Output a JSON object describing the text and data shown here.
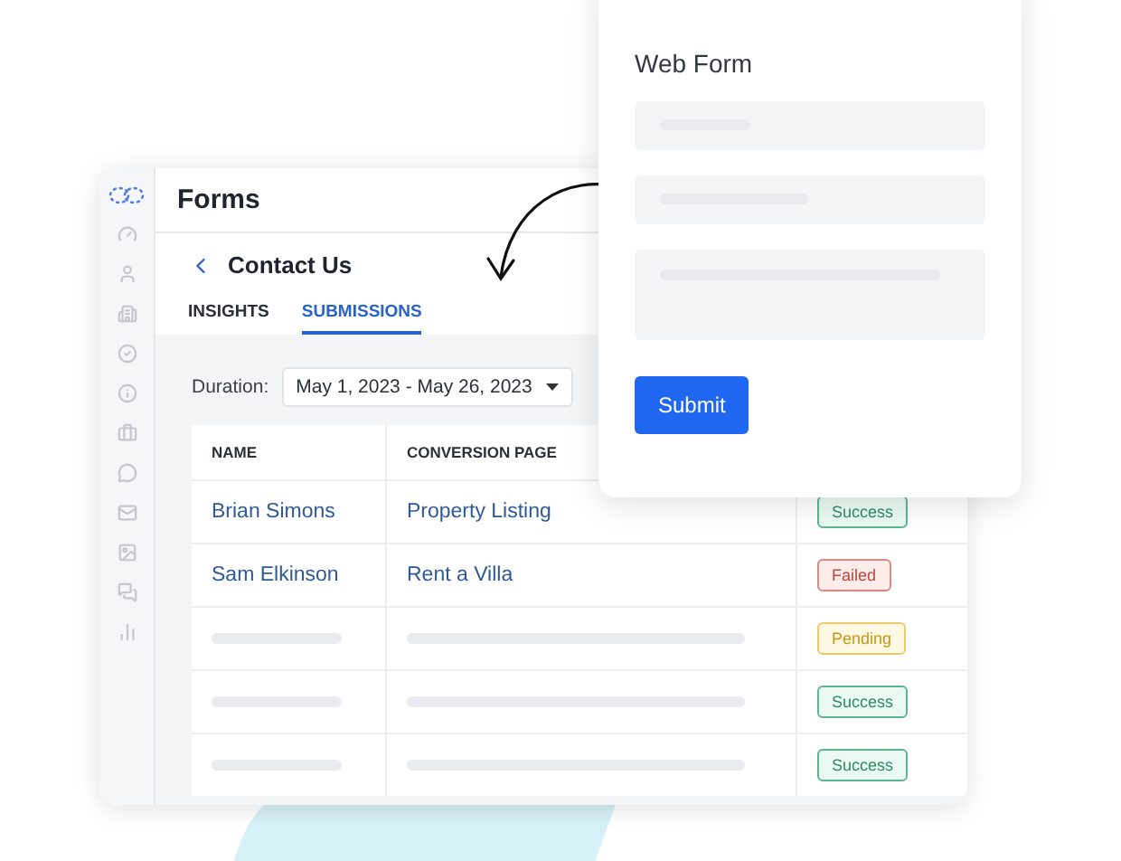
{
  "app": {
    "title": "Forms",
    "page_title": "Contact Us",
    "tabs": [
      {
        "label": "INSIGHTS",
        "selected": false
      },
      {
        "label": "SUBMISSIONS",
        "selected": true
      }
    ],
    "duration": {
      "label": "Duration:",
      "value": "May 1, 2023 - May 26, 2023"
    },
    "table": {
      "columns": [
        "NAME",
        "CONVERSION PAGE"
      ],
      "rows": [
        {
          "kind": "filled",
          "name": "Brian Simons",
          "page": "Property Listing",
          "status": {
            "label": "Success",
            "kind": "success"
          }
        },
        {
          "kind": "filled",
          "name": "Sam Elkinson",
          "page": "Rent a Villa",
          "status": {
            "label": "Failed",
            "kind": "failed"
          }
        },
        {
          "kind": "skeleton",
          "status": {
            "label": "Pending",
            "kind": "pending"
          }
        },
        {
          "kind": "skeleton",
          "status": {
            "label": "Success",
            "kind": "success"
          }
        },
        {
          "kind": "skeleton",
          "status": {
            "label": "Success",
            "kind": "success"
          }
        }
      ]
    }
  },
  "web_form": {
    "title": "Web Form",
    "fields": [
      {
        "kind": "line"
      },
      {
        "kind": "line"
      },
      {
        "kind": "area"
      }
    ],
    "button": "Submit"
  }
}
